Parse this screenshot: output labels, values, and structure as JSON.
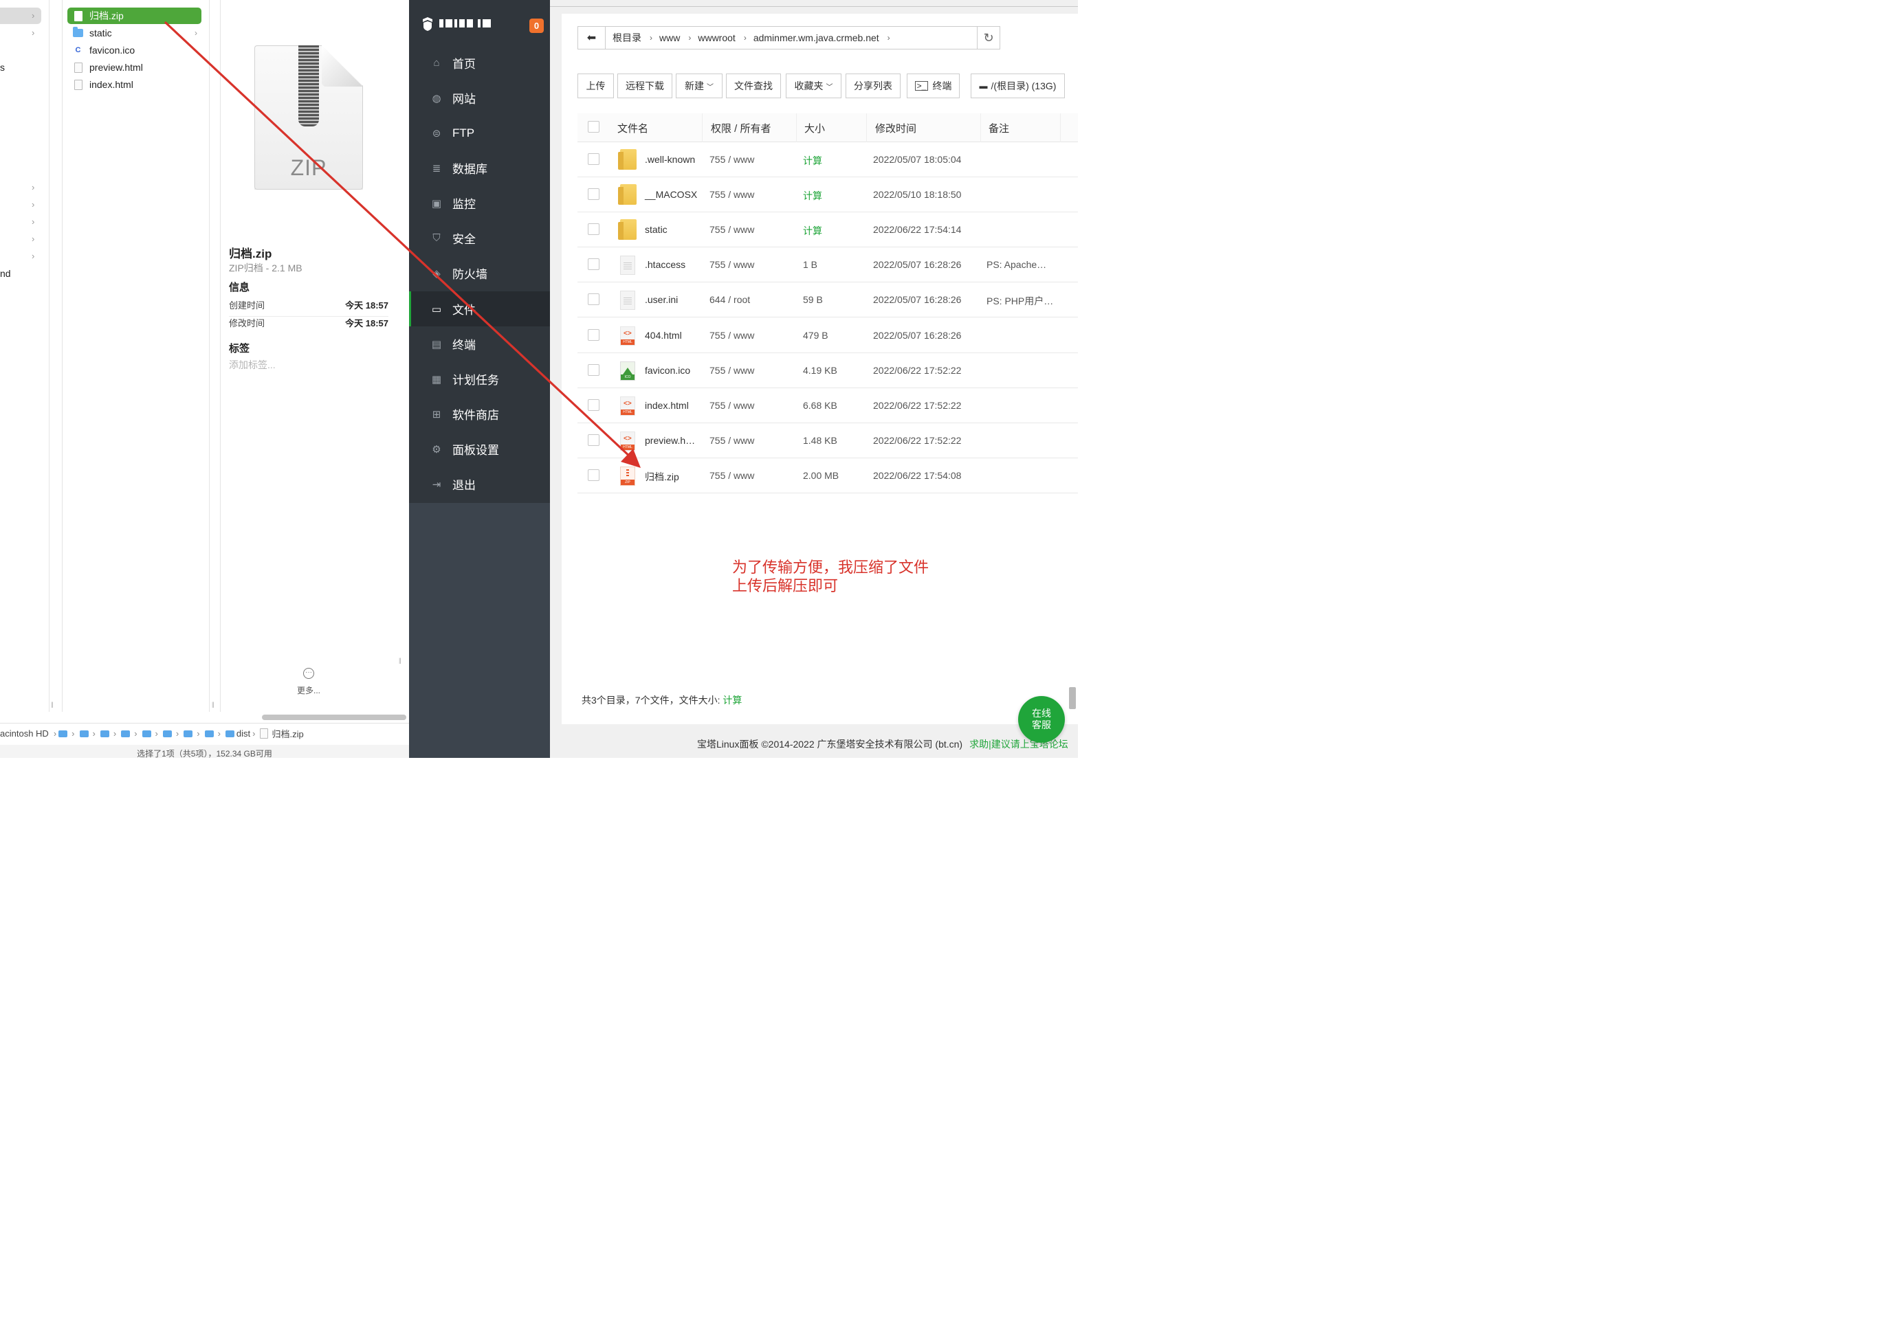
{
  "finder": {
    "col_a": {
      "fragments": [
        "s",
        "nd"
      ]
    },
    "items": [
      {
        "name": "归档.zip",
        "icon": "zip-document-icon",
        "selected": true
      },
      {
        "name": "static",
        "icon": "folder-icon",
        "has_children": true
      },
      {
        "name": "favicon.ico",
        "icon": "c-icon"
      },
      {
        "name": "preview.html",
        "icon": "document-icon"
      },
      {
        "name": "index.html",
        "icon": "document-icon"
      }
    ],
    "preview": {
      "zip_label": "ZIP",
      "title": "归档.zip",
      "subtitle": "ZIP归档 - 2.1 MB",
      "info_heading": "信息",
      "created_label": "创建时间",
      "created_value": "今天 18:57",
      "modified_label": "修改时间",
      "modified_value": "今天 18:57",
      "tags_heading": "标签",
      "tags_placeholder": "添加标签...",
      "more_label": "更多..."
    },
    "pathbar": {
      "root": "acintosh HD",
      "last_folder": "dist",
      "file": "归档.zip"
    },
    "status": "选择了1项（共5项），152.34 GB可用"
  },
  "sidebar": {
    "badge": "0",
    "items": [
      {
        "label": "首页",
        "icon": "home-icon"
      },
      {
        "label": "网站",
        "icon": "globe-icon"
      },
      {
        "label": "FTP",
        "icon": "ftp-icon"
      },
      {
        "label": "数据库",
        "icon": "database-icon"
      },
      {
        "label": "监控",
        "icon": "monitor-icon"
      },
      {
        "label": "安全",
        "icon": "shield-icon"
      },
      {
        "label": "防火墙",
        "icon": "firewall-icon"
      },
      {
        "label": "文件",
        "icon": "folder-icon",
        "active": true
      },
      {
        "label": "终端",
        "icon": "terminal-icon"
      },
      {
        "label": "计划任务",
        "icon": "calendar-icon"
      },
      {
        "label": "软件商店",
        "icon": "apps-icon"
      },
      {
        "label": "面板设置",
        "icon": "gear-icon"
      },
      {
        "label": "退出",
        "icon": "logout-icon"
      }
    ]
  },
  "main": {
    "breadcrumb": [
      "根目录",
      "www",
      "wwwroot",
      "adminmer.wm.java.crmeb.net"
    ],
    "toolbar": {
      "upload": "上传",
      "remote_download": "远程下载",
      "new": "新建",
      "find": "文件查找",
      "favorites": "收藏夹",
      "share_list": "分享列表",
      "terminal": "终端",
      "disk": "/(根目录) (13G)"
    },
    "columns": {
      "name": "文件名",
      "perm": "权限 / 所有者",
      "size": "大小",
      "mtime": "修改时间",
      "note": "备注"
    },
    "rows": [
      {
        "name": ".well-known",
        "type": "folder",
        "perm": "755 / www",
        "size": "计算",
        "mtime": "2022/05/07 18:05:04",
        "note": ""
      },
      {
        "name": "__MACOSX",
        "type": "folder",
        "perm": "755 / www",
        "size": "计算",
        "mtime": "2022/05/10 18:18:50",
        "note": ""
      },
      {
        "name": "static",
        "type": "folder",
        "perm": "755 / www",
        "size": "计算",
        "mtime": "2022/06/22 17:54:14",
        "note": ""
      },
      {
        "name": ".htaccess",
        "type": "text",
        "perm": "755 / www",
        "size": "1 B",
        "mtime": "2022/05/07 16:28:26",
        "note": "PS: Apache…"
      },
      {
        "name": ".user.ini",
        "type": "text",
        "perm": "644 / root",
        "size": "59 B",
        "mtime": "2022/05/07 16:28:26",
        "note": "PS: PHP用户…"
      },
      {
        "name": "404.html",
        "type": "html",
        "perm": "755 / www",
        "size": "479 B",
        "mtime": "2022/05/07 16:28:26",
        "note": ""
      },
      {
        "name": "favicon.ico",
        "type": "ico",
        "perm": "755 / www",
        "size": "4.19 KB",
        "mtime": "2022/06/22 17:52:22",
        "note": ""
      },
      {
        "name": "index.html",
        "type": "html",
        "perm": "755 / www",
        "size": "6.68 KB",
        "mtime": "2022/06/22 17:52:22",
        "note": ""
      },
      {
        "name": "preview.h…",
        "type": "html",
        "perm": "755 / www",
        "size": "1.48 KB",
        "mtime": "2022/06/22 17:52:22",
        "note": ""
      },
      {
        "name": "归档.zip",
        "type": "zip",
        "perm": "755 / www",
        "size": "2.00 MB",
        "mtime": "2022/06/22 17:54:08",
        "note": ""
      }
    ],
    "summary_prefix": "共3个目录，7个文件，文件大小: ",
    "summary_link": "计算",
    "annotation": [
      "为了传输方便，我压缩了文件",
      "上传后解压即可"
    ],
    "footer_text": "宝塔Linux面板 ©2014-2022 广东堡塔安全技术有限公司 (bt.cn)",
    "footer_link": "求助|建议请上宝塔论坛",
    "chat": [
      "在线",
      "客服"
    ]
  },
  "colors": {
    "finder_selection": "#4ea73a",
    "bt_green": "#20a53a",
    "badge_orange": "#f0712c",
    "annotation_red": "#d8332b",
    "sidebar_bg": "#30363c"
  }
}
